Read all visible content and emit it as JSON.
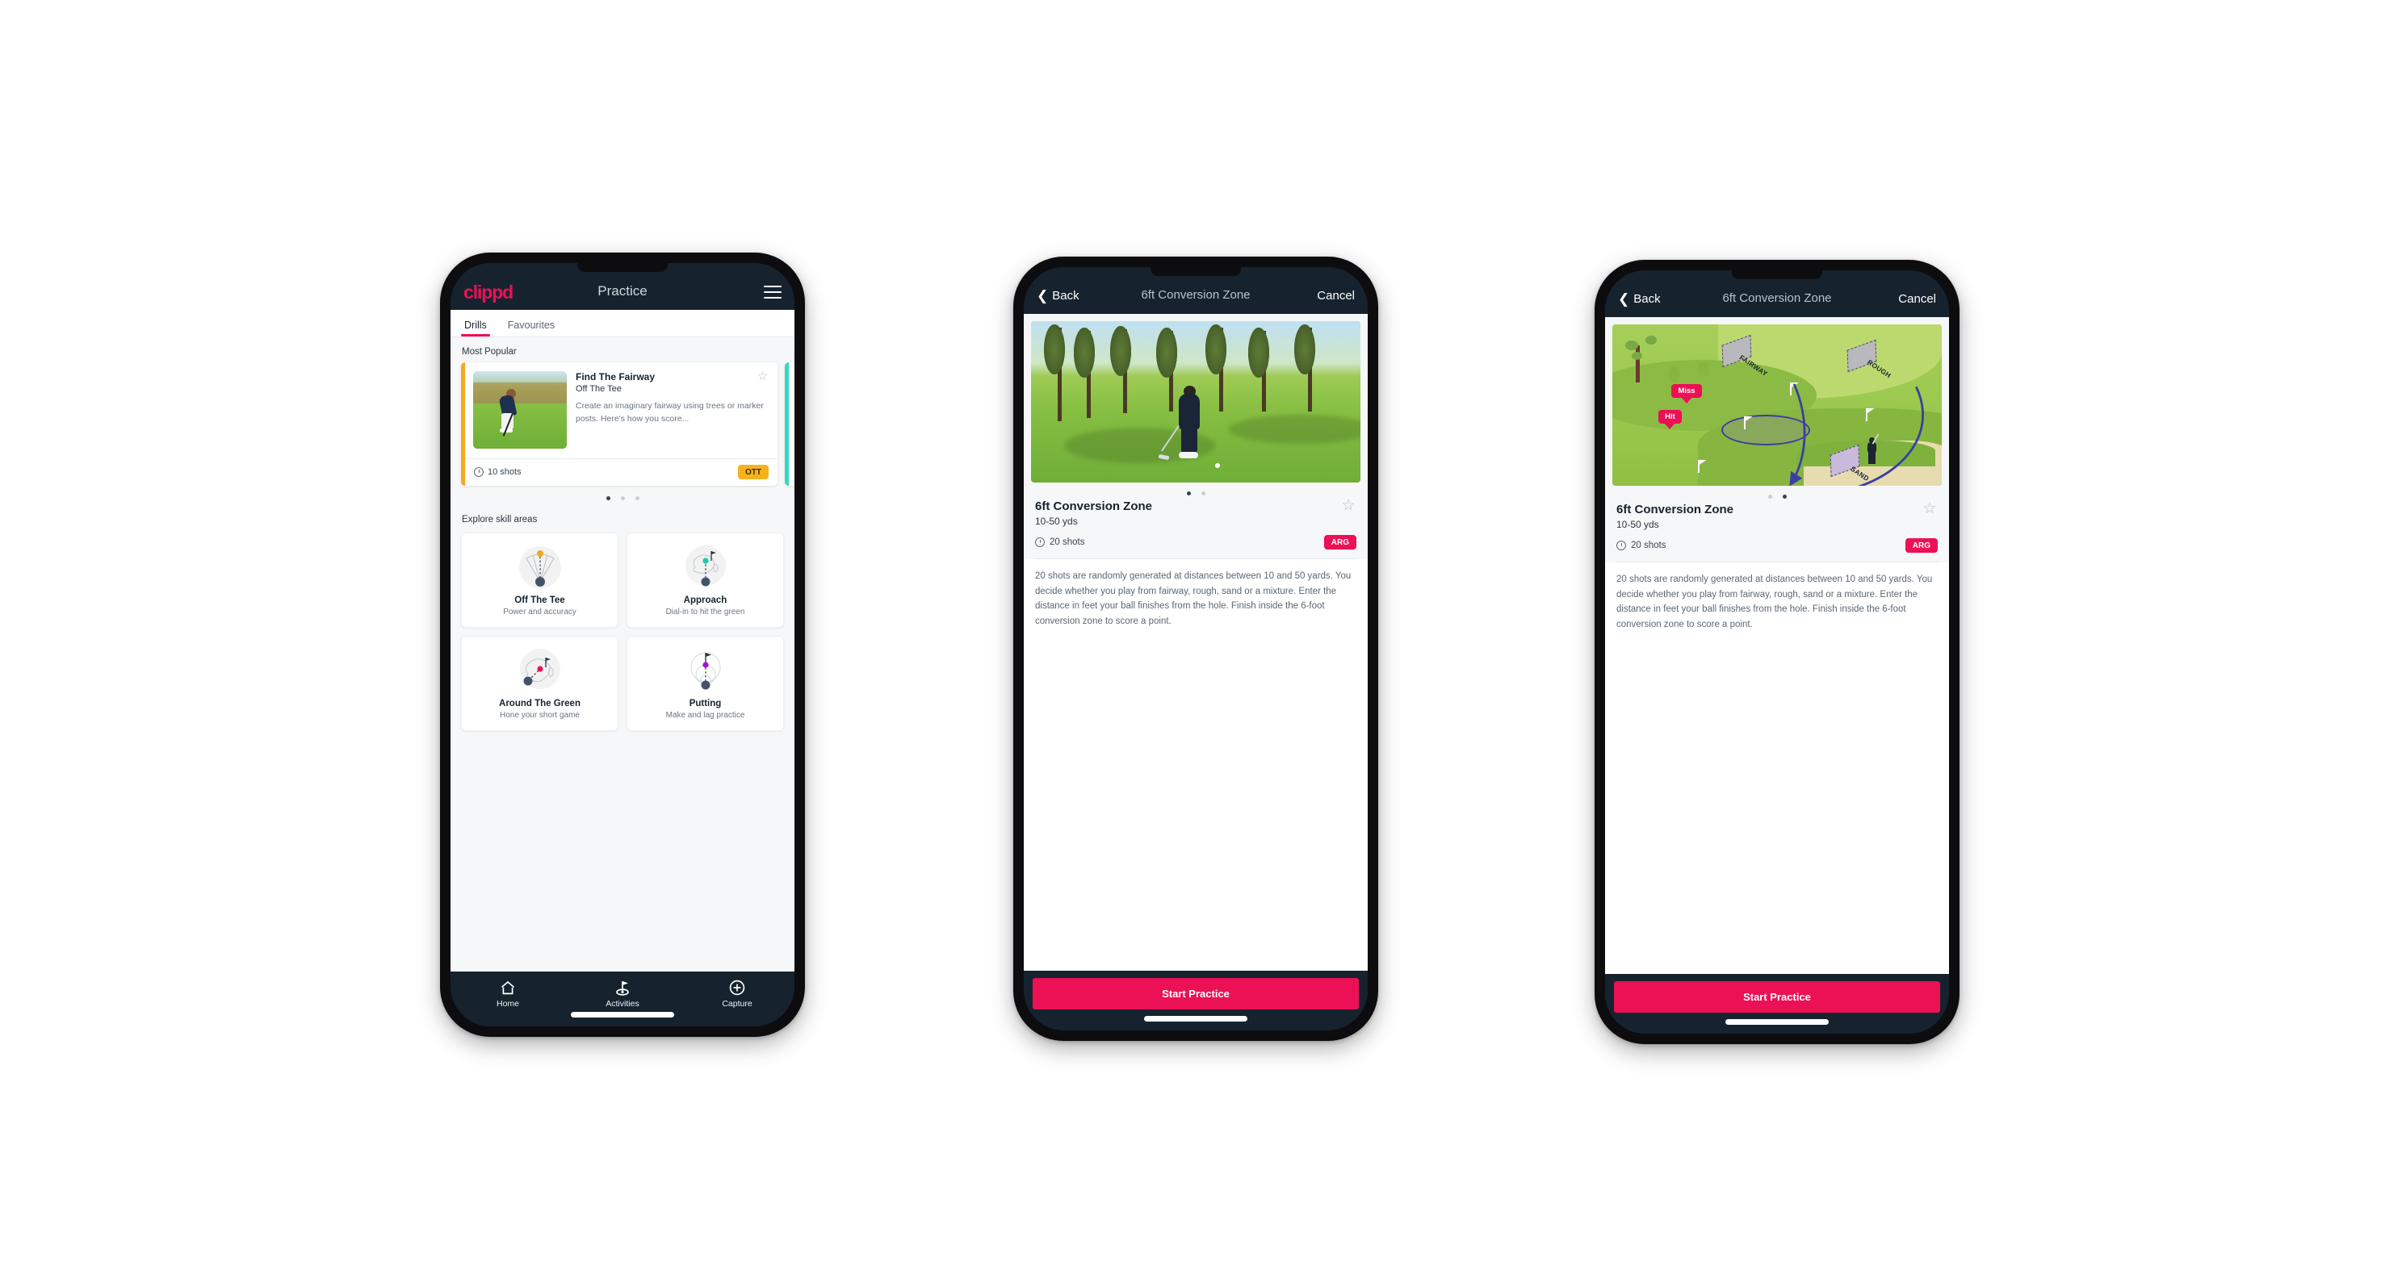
{
  "colors": {
    "brand_pink": "#ec1055",
    "nav_dark": "#16232e",
    "ott_yellow": "#f5b21c",
    "arg_pink": "#ec1055",
    "teal_accent": "#35d7c2",
    "page_bg": "#f6f7f8"
  },
  "phone1": {
    "topnav": {
      "logo": "clippd",
      "title": "Practice",
      "menu_icon": "hamburger-icon"
    },
    "tabs": [
      {
        "label": "Drills",
        "active": true
      },
      {
        "label": "Favourites",
        "active": false
      }
    ],
    "sections": {
      "most_popular_title": "Most Popular",
      "explore_title": "Explore skill areas"
    },
    "drill_card": {
      "title": "Find The Fairway",
      "subtitle": "Off The Tee",
      "description": "Create an imaginary fairway using trees or marker posts. Here's how you score...",
      "shots": "10 shots",
      "tag": "OTT",
      "star_icon": "star-outline-icon",
      "clock_icon": "clock-icon",
      "accent_color": "#f5a81c"
    },
    "carousel_dots": [
      true,
      false,
      false
    ],
    "skill_areas": [
      {
        "name": "Off The Tee",
        "desc": "Power and accuracy",
        "icon": "tee-fan-icon",
        "dot_color": "#f5a81c"
      },
      {
        "name": "Approach",
        "desc": "Dial-in to hit the green",
        "icon": "approach-green-icon",
        "dot_color": "#1fc9ad"
      },
      {
        "name": "Around The Green",
        "desc": "Hone your short game",
        "icon": "around-green-icon",
        "dot_color": "#ec1055"
      },
      {
        "name": "Putting",
        "desc": "Make and lag practice",
        "icon": "putting-rings-icon",
        "dot_color": "#a013d8"
      }
    ],
    "tabbar": [
      {
        "label": "Home",
        "icon": "home-icon",
        "active": false
      },
      {
        "label": "Activities",
        "icon": "golf-flag-icon",
        "active": true
      },
      {
        "label": "Capture",
        "icon": "plus-circle-icon",
        "active": false
      }
    ]
  },
  "phone2": {
    "nav": {
      "back": "Back",
      "back_icon": "chevron-left-icon",
      "title": "6ft Conversion Zone",
      "cancel": "Cancel"
    },
    "media_kind": "photo-golfer-chipping",
    "dots": [
      true,
      false
    ],
    "detail": {
      "title": "6ft Conversion Zone",
      "subtitle": "10-50 yds",
      "shots": "20 shots",
      "tag": "ARG",
      "star_icon": "star-outline-icon",
      "clock_icon": "clock-icon",
      "description": "20 shots are randomly generated at distances between 10 and 50 yards. You decide whether you play from fairway, rough, sand or a mixture. Enter the distance in feet your ball finishes from the hole. Finish inside the 6-foot conversion zone to score a point."
    },
    "cta": "Start Practice"
  },
  "phone3": {
    "nav": {
      "back": "Back",
      "back_icon": "chevron-left-icon",
      "title": "6ft Conversion Zone",
      "cancel": "Cancel"
    },
    "media_kind": "illustration-course-map",
    "illustration": {
      "zone_labels": [
        "FAIRWAY",
        "ROUGH",
        "SAND"
      ],
      "bubbles": [
        "Miss",
        "Hit"
      ]
    },
    "dots": [
      false,
      true
    ],
    "detail": {
      "title": "6ft Conversion Zone",
      "subtitle": "10-50 yds",
      "shots": "20 shots",
      "tag": "ARG",
      "star_icon": "star-outline-icon",
      "clock_icon": "clock-icon",
      "description": "20 shots are randomly generated at distances between 10 and 50 yards. You decide whether you play from fairway, rough, sand or a mixture. Enter the distance in feet your ball finishes from the hole. Finish inside the 6-foot conversion zone to score a point."
    },
    "cta": "Start Practice"
  }
}
